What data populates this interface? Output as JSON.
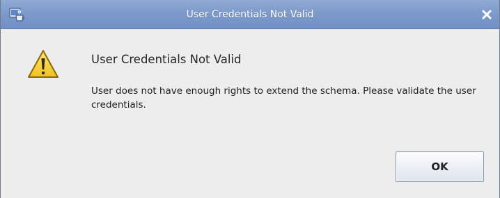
{
  "window": {
    "title": "User Credentials Not Valid",
    "app_icon": "java-cup-icon",
    "close_icon": "close-icon"
  },
  "dialog": {
    "icon": "warning-triangle-icon",
    "heading": "User Credentials Not Valid",
    "message": "User does not have enough rights  to extend the schema.  Please validate the user credentials.",
    "ok_label": "OK"
  },
  "colors": {
    "titlebar": "#7d9acb",
    "window_background": "#ededed",
    "warning_fill": "#f7d33b",
    "button_border": "#8393ad"
  }
}
